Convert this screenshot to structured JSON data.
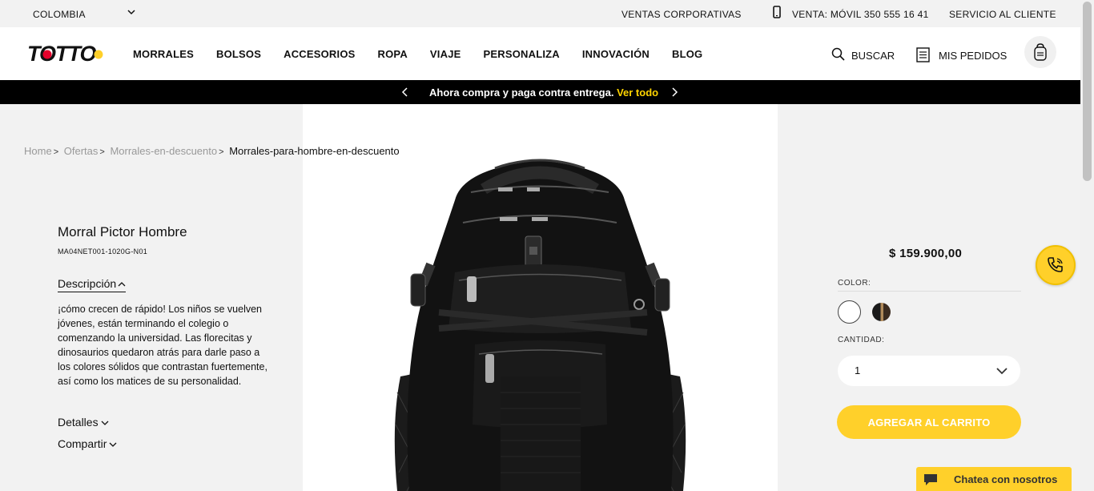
{
  "topbar": {
    "country": "COLOMBIA",
    "corporate": "VENTAS CORPORATIVAS",
    "phone": "VENTA: MÓVIL 350 555 16 41",
    "service": "SERVICIO AL CLIENTE"
  },
  "header": {
    "logo_text": "TOTTO",
    "nav": [
      "MORRALES",
      "BOLSOS",
      "ACCESORIOS",
      "ROPA",
      "VIAJE",
      "PERSONALIZA",
      "INNOVACIÓN",
      "BLOG"
    ],
    "search_label": "BUSCAR",
    "orders_label": "MIS PEDIDOS"
  },
  "promo": {
    "message": "Ahora compra y paga contra entrega.",
    "link": "Ver todo"
  },
  "breadcrumb": {
    "items": [
      "Home",
      "Ofertas",
      "Morrales-en-descuento"
    ],
    "current": "Morrales-para-hombre-en-descuento"
  },
  "product": {
    "name": "Morral Pictor Hombre",
    "sku": "MA04NET001-1020G-N01",
    "description_title": "Descripción",
    "description": "¡cómo crecen de rápido! Los niños se vuelven jóvenes, están terminando el colegio o comenzando la universidad. Las florecitas y dinosaurios quedaron atrás para darle paso a los colores sólidos que contrastan fuertemente, así como los matices de su personalidad.",
    "details_title": "Detalles",
    "share_title": "Compartir",
    "price": "$ 159.900,00",
    "color_label": "COLOR:",
    "quantity_label": "CANTIDAD:",
    "quantity_value": "1",
    "add_to_cart": "AGREGAR AL CARRITO"
  },
  "chat": {
    "label": "Chatea con nosotros"
  },
  "colors": {
    "accent": "#ffd02a",
    "promo_bg": "#000000",
    "promo_link": "#ffd400"
  }
}
